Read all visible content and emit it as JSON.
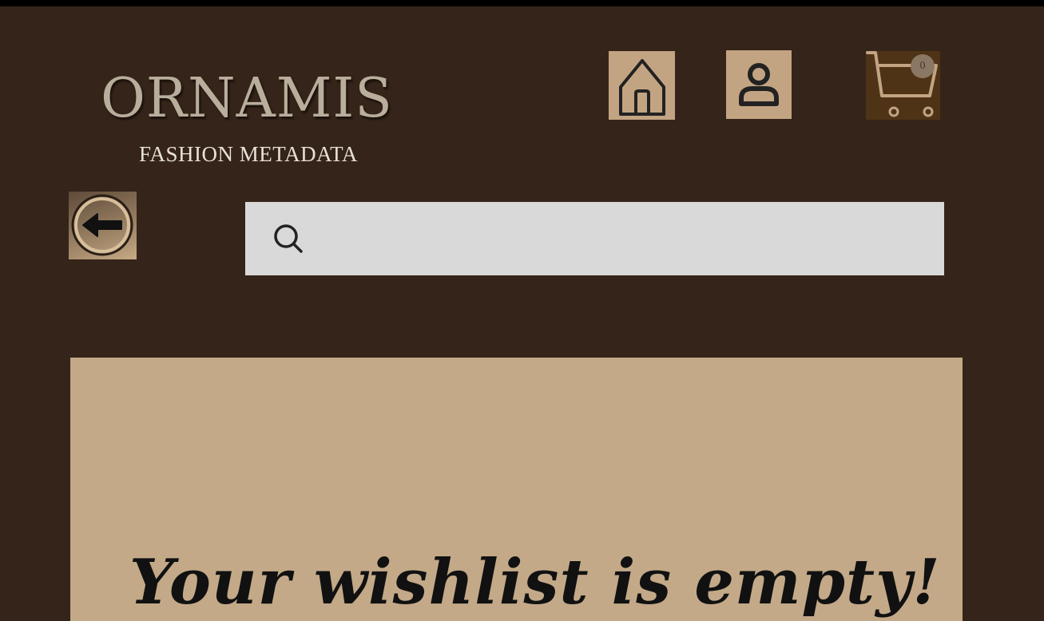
{
  "header": {
    "logo_title": "ORNAMIS",
    "logo_subtitle": "FASHION METADATA"
  },
  "nav": {
    "home_icon": "home-icon",
    "profile_icon": "user-icon",
    "cart_icon": "shopping-cart-icon",
    "cart_count": "0"
  },
  "back": {
    "icon": "arrow-left-circle-icon"
  },
  "search": {
    "icon": "search-icon",
    "value": "",
    "placeholder": ""
  },
  "wishlist": {
    "empty_message": "Your wishlist is empty!"
  },
  "colors": {
    "background": "#352419",
    "accent": "#c3a482",
    "cart_bg": "#4e3316",
    "panel": "#c3a988",
    "search_bg": "#d9d9d9"
  }
}
